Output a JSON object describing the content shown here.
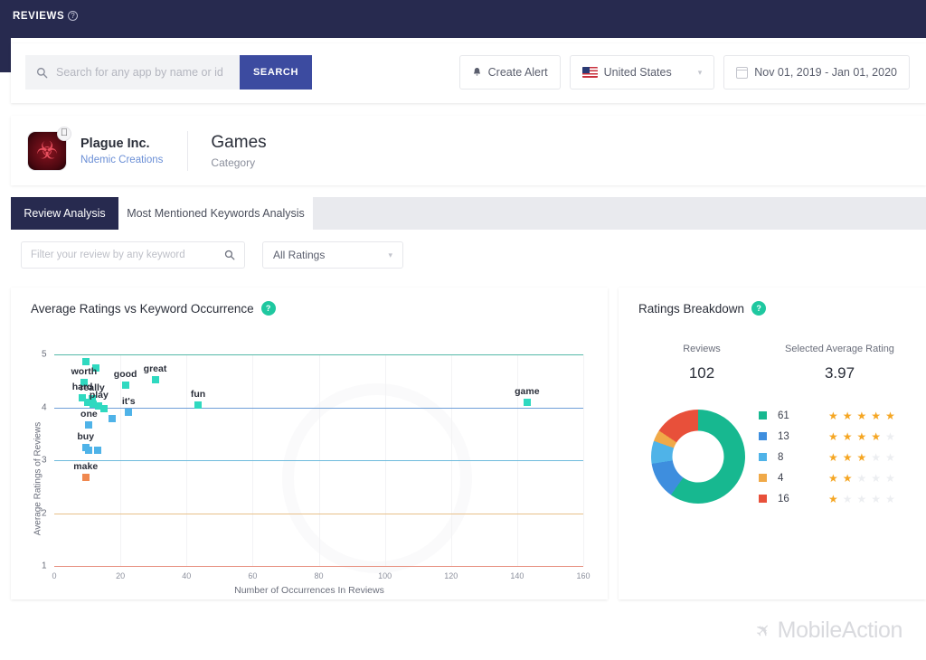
{
  "topbar": {
    "title": "REVIEWS",
    "help_icon": "question-circle-icon"
  },
  "search": {
    "placeholder": "Search for any app by name or id",
    "value": "",
    "button_label": "SEARCH",
    "icon": "search-icon"
  },
  "controls": {
    "create_alert": {
      "label": "Create Alert",
      "icon": "bell-icon"
    },
    "country": {
      "label": "United States",
      "icon": "us-flag-icon",
      "chevron": "▾"
    },
    "date_range": {
      "label": "Nov 01, 2019  -  Jan 01, 2020",
      "icon": "calendar-icon"
    }
  },
  "app": {
    "name": "Plague Inc.",
    "developer": "Ndemic Creations",
    "category_title": "Games",
    "category_sub": "Category",
    "icon": "plague-inc-app-icon",
    "platform_badge": "apple-icon"
  },
  "tabs": [
    {
      "label": "Review Analysis",
      "active": true
    },
    {
      "label": "Most Mentioned Keywords Analysis",
      "active": false
    }
  ],
  "filters": {
    "keyword_placeholder": "Filter your review by any keyword",
    "keyword_value": "",
    "search_icon": "search-icon",
    "ratings_value": "All Ratings",
    "chevron": "▾"
  },
  "scatter_card": {
    "title": "Average Ratings vs Keyword Occurrence",
    "help_badge": "?"
  },
  "breakdown_card": {
    "title": "Ratings Breakdown",
    "help_badge": "?",
    "reviews_label": "Reviews",
    "reviews_value": "102",
    "avg_label": "Selected Average Rating",
    "avg_value": "3.97"
  },
  "colors": {
    "nav": "#272a4f",
    "accent": "#3c4ba0",
    "teal": "#1fc8a0",
    "star": "#f5a623",
    "rating5": "#17b890",
    "rating4": "#3e8ede",
    "rating3": "#4fb3e8",
    "rating2": "#f0a948",
    "rating1": "#e8503a"
  },
  "chart_data": [
    {
      "type": "scatter",
      "title": "Average Ratings vs Keyword Occurrence",
      "xlabel": "Number of Occurrences In Reviews",
      "ylabel": "Average Ratings of Reviews",
      "xlim": [
        0,
        160
      ],
      "ylim": [
        1,
        5
      ],
      "xticks": [
        0,
        20,
        40,
        60,
        80,
        100,
        120,
        140,
        160
      ],
      "yticks": [
        1,
        2,
        3,
        4,
        5
      ],
      "grid": true,
      "gridline_colors": {
        "5": "#54b8a8",
        "4": "#6f9fd8",
        "3": "#6fbbdd",
        "2": "#e8c08a",
        "1": "#e79080"
      },
      "points": [
        {
          "label": "",
          "x": 9.5,
          "y": 4.87,
          "color": "#2fd9c0"
        },
        {
          "label": "",
          "x": 12.5,
          "y": 4.74,
          "color": "#2fd9c0"
        },
        {
          "label": "worth",
          "x": 9.0,
          "y": 4.47,
          "color": "#2fd9c0",
          "label_dx": 0,
          "label_dy": -12
        },
        {
          "label": "good",
          "x": 21.5,
          "y": 4.42,
          "color": "#2fd9c0",
          "label_dx": 0,
          "label_dy": -12
        },
        {
          "label": "great",
          "x": 30.5,
          "y": 4.52,
          "color": "#2fd9c0",
          "label_dx": 0,
          "label_dy": -12
        },
        {
          "label": "hard",
          "x": 8.5,
          "y": 4.18,
          "color": "#2fd9c0",
          "label_dx": 0,
          "label_dy": -12
        },
        {
          "label": "really",
          "x": 11.5,
          "y": 4.16,
          "color": "#2fd9c0",
          "label_dx": 0,
          "label_dy": -12
        },
        {
          "label": "",
          "x": 10.0,
          "y": 4.1,
          "color": "#2fd9c0"
        },
        {
          "label": "",
          "x": 11.8,
          "y": 4.06,
          "color": "#2fd9c0"
        },
        {
          "label": "play",
          "x": 13.5,
          "y": 4.02,
          "color": "#2fd9c0",
          "label_dx": 0,
          "label_dy": -12
        },
        {
          "label": "",
          "x": 15.0,
          "y": 3.97,
          "color": "#2fd9c0"
        },
        {
          "label": "fun",
          "x": 43.5,
          "y": 4.05,
          "color": "#2fd9c0",
          "label_dx": 0,
          "label_dy": -12
        },
        {
          "label": "game",
          "x": 143.0,
          "y": 4.1,
          "color": "#2fd9c0",
          "label_dx": 0,
          "label_dy": -12
        },
        {
          "label": "it's",
          "x": 22.5,
          "y": 3.9,
          "color": "#4fb3e8",
          "label_dx": 0,
          "label_dy": -12
        },
        {
          "label": "",
          "x": 17.5,
          "y": 3.78,
          "color": "#4fb3e8"
        },
        {
          "label": "one",
          "x": 10.5,
          "y": 3.67,
          "color": "#4fb3e8",
          "label_dx": 0,
          "label_dy": -12
        },
        {
          "label": "buy",
          "x": 9.5,
          "y": 3.24,
          "color": "#4fb3e8",
          "label_dx": 0,
          "label_dy": -12
        },
        {
          "label": "",
          "x": 10.3,
          "y": 3.18,
          "color": "#4fb3e8"
        },
        {
          "label": "",
          "x": 13.0,
          "y": 3.18,
          "color": "#4fb3e8"
        },
        {
          "label": "make",
          "x": 9.5,
          "y": 2.68,
          "color": "#f0884f",
          "label_dx": 0,
          "label_dy": -12
        }
      ]
    },
    {
      "type": "pie",
      "title": "Ratings Breakdown",
      "subtype": "donut",
      "labels": [
        "5 stars",
        "4 stars",
        "3 stars",
        "2 stars",
        "1 star"
      ],
      "values": [
        61,
        13,
        8,
        4,
        16
      ],
      "colors": [
        "#17b890",
        "#3e8ede",
        "#4fb3e8",
        "#f0a948",
        "#e8503a"
      ],
      "total": 102,
      "legend_position": "right",
      "legend": [
        {
          "count": "61",
          "stars": 5,
          "color": "#17b890"
        },
        {
          "count": "13",
          "stars": 4,
          "color": "#3e8ede"
        },
        {
          "count": "8",
          "stars": 3,
          "color": "#4fb3e8"
        },
        {
          "count": "4",
          "stars": 2,
          "color": "#f0a948"
        },
        {
          "count": "16",
          "stars": 1,
          "color": "#e8503a"
        }
      ]
    }
  ],
  "watermark": {
    "text": "MobileAction",
    "icon": "rocket-icon"
  }
}
